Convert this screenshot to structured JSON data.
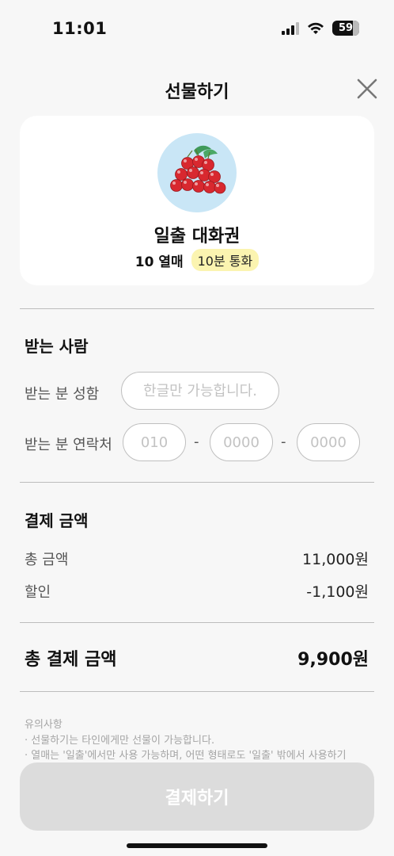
{
  "status_bar": {
    "time": "11:01",
    "battery": "59",
    "signal_icon": "signal-bars-icon",
    "wifi_icon": "wifi-icon"
  },
  "header": {
    "title": "선물하기",
    "close_icon": "close-icon"
  },
  "product": {
    "image_icon": "cherries-icon",
    "name": "일출 대화권",
    "count": "10 열매",
    "duration": "10분 통화"
  },
  "recipient": {
    "section_title": "받는 사람",
    "name_label": "받는 분 성함",
    "name_placeholder": "한글만 가능합니다.",
    "phone_label": "받는 분 연락처",
    "phone_1_placeholder": "010",
    "phone_2_placeholder": "0000",
    "phone_3_placeholder": "0000",
    "separator": "-"
  },
  "payment": {
    "section_title": "결제 금액",
    "total_amount_label": "총 금액",
    "total_amount_value": "11,000원",
    "discount_label": "할인",
    "discount_value": "-1,100원",
    "final_label": "총 결제 금액",
    "final_value": "9,900원"
  },
  "notice": {
    "title": "유의사항",
    "line1": "· 선물하기는 타인에게만 선물이 가능합니다.",
    "line2": "· 열매는 '일출'에서만 사용 가능하며, 어떤 형태로도 '일출' 밖에서 사용하기"
  },
  "pay_button": {
    "label": "결제하기",
    "color": "#dcdcdc"
  },
  "colors": {
    "background": "#f7f7f7",
    "badge": "#fbf4b0",
    "image_bg": "#c9e6f6",
    "cherry": "#d8282f"
  }
}
